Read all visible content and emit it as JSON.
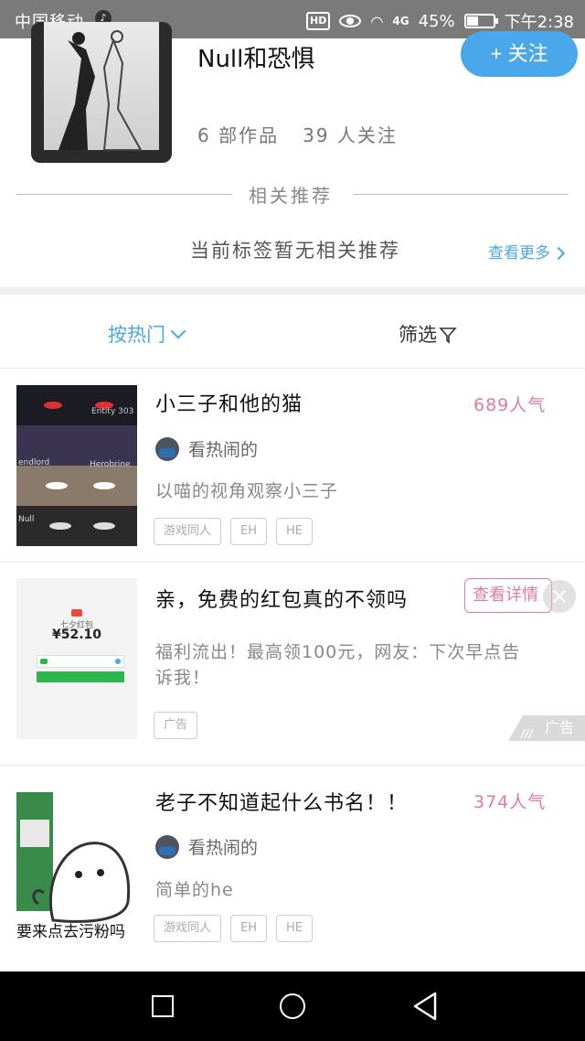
{
  "status_bar": {
    "carrier": "中国移动",
    "hd": "HD",
    "signal": "4G",
    "battery": "45%",
    "battery_level": 0.45,
    "time": "下午2:38"
  },
  "author": {
    "name": "Null和恐惧",
    "follow_label": "+ 关注",
    "works_count": "6 部作品",
    "followers": "39 人关注"
  },
  "related": {
    "title": "相关推荐",
    "empty_text": "当前标签暂无相关推荐",
    "see_more": "查看更多"
  },
  "toolbar": {
    "sort_label": "按热门",
    "filter_label": "筛选"
  },
  "works": [
    {
      "title": "小三子和他的猫",
      "popularity": "689人气",
      "poster": "看热闹的",
      "desc": "以喵的视角观察小三子",
      "tags": [
        "游戏同人",
        "EH",
        "HE"
      ],
      "cover_texts": [
        "Entity 303",
        "Herobrine",
        "endlord",
        "Null"
      ]
    },
    {
      "title": "老子不知道起什么书名！！",
      "popularity": "374人气",
      "poster": "看热闹的",
      "desc": "简单的he",
      "tags": [
        "游戏同人",
        "EH",
        "HE"
      ],
      "cover_texts": [
        "要来点去污粉吗"
      ]
    }
  ],
  "ad": {
    "title": "亲，免费的红包真的不领吗",
    "detail_label": "查看详情",
    "desc_line1": "福利流出！最高领100元，网友：下次早点告",
    "desc_line2": "诉我！",
    "tag": "广告",
    "badge": "广告",
    "image_title": "七夕红包",
    "image_amount": "¥52.10"
  }
}
